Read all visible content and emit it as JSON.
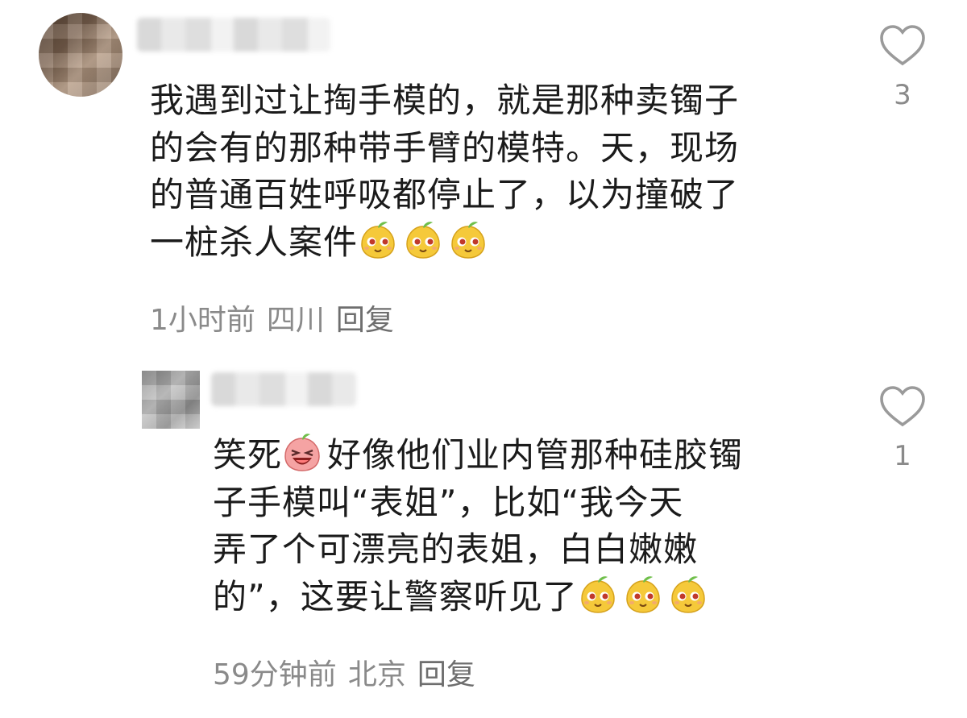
{
  "comments": [
    {
      "lines": [
        "我遇到过让掏手模的，就是那种卖镯子",
        "的会有的那种带手臂的模特。天，现场",
        "的普通百姓呼吸都停止了，以为撞破了",
        "一桩杀人案件"
      ],
      "trailing_emojis": [
        "smug-mango-emoji",
        "smug-mango-emoji",
        "smug-mango-emoji"
      ],
      "time": "1小时前",
      "location": "四川",
      "reply_label": "回复",
      "like_count": "3"
    },
    {
      "line1_before_emoji": "笑死",
      "inline_emoji": "laughing-emoji",
      "line1_after_emoji": "好像他们业内管那种硅胶镯",
      "lines": [
        "子手模叫“表姐”，比如“我今天",
        "弄了个可漂亮的表姐，白白嫩嫩",
        "的”，这要让警察听见了"
      ],
      "trailing_emojis": [
        "smug-mango-emoji",
        "smug-mango-emoji",
        "smug-mango-emoji"
      ],
      "time": "59分钟前",
      "location": "北京",
      "reply_label": "回复",
      "like_count": "1"
    }
  ],
  "colors": {
    "text": "#1b1b1b",
    "meta": "#8a8a8a",
    "heart_outline": "#9a9a9a",
    "emoji_mango": "#f5c93a",
    "emoji_laugh": "#f08a8a"
  }
}
